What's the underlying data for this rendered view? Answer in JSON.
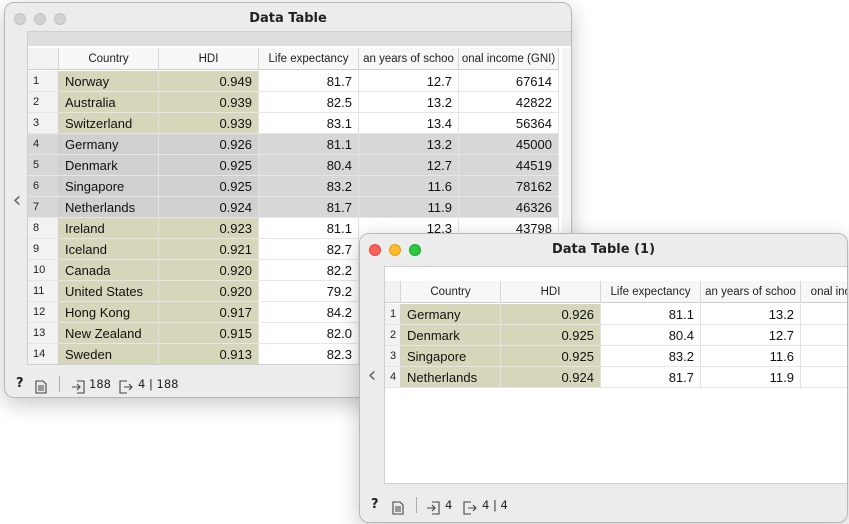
{
  "window1": {
    "title": "Data Table",
    "headers": [
      "Country",
      "HDI",
      "Life expectancy",
      "an years of schoo",
      "onal income (GNI)"
    ],
    "rows": [
      [
        "1",
        "Norway",
        "0.949",
        "81.7",
        "12.7",
        "67614"
      ],
      [
        "2",
        "Australia",
        "0.939",
        "82.5",
        "13.2",
        "42822"
      ],
      [
        "3",
        "Switzerland",
        "0.939",
        "83.1",
        "13.4",
        "56364"
      ],
      [
        "4",
        "Germany",
        "0.926",
        "81.1",
        "13.2",
        "45000"
      ],
      [
        "5",
        "Denmark",
        "0.925",
        "80.4",
        "12.7",
        "44519"
      ],
      [
        "6",
        "Singapore",
        "0.925",
        "83.2",
        "11.6",
        "78162"
      ],
      [
        "7",
        "Netherlands",
        "0.924",
        "81.7",
        "11.9",
        "46326"
      ],
      [
        "8",
        "Ireland",
        "0.923",
        "81.1",
        "12.3",
        "43798"
      ],
      [
        "9",
        "Iceland",
        "0.921",
        "82.7",
        "",
        ""
      ],
      [
        "10",
        "Canada",
        "0.920",
        "82.2",
        "",
        ""
      ],
      [
        "11",
        "United States",
        "0.920",
        "79.2",
        "",
        ""
      ],
      [
        "12",
        "Hong Kong",
        "0.917",
        "84.2",
        "",
        ""
      ],
      [
        "13",
        "New Zealand",
        "0.915",
        "82.0",
        "",
        ""
      ],
      [
        "14",
        "Sweden",
        "0.913",
        "82.3",
        "",
        ""
      ]
    ],
    "selected_rows": [
      4,
      5,
      6,
      7
    ],
    "status": {
      "input_count": "188",
      "output_count": "4 | 188"
    }
  },
  "window2": {
    "title": "Data Table (1)",
    "headers": [
      "Country",
      "HDI",
      "Life expectancy",
      "an years of schoo",
      "onal inc"
    ],
    "rows": [
      [
        "1",
        "Germany",
        "0.926",
        "81.1",
        "13.2",
        ""
      ],
      [
        "2",
        "Denmark",
        "0.925",
        "80.4",
        "12.7",
        ""
      ],
      [
        "3",
        "Singapore",
        "0.925",
        "83.2",
        "11.6",
        ""
      ],
      [
        "4",
        "Netherlands",
        "0.924",
        "81.7",
        "11.9",
        ""
      ]
    ],
    "status": {
      "input_count": "4",
      "output_count": "4 | 4"
    }
  },
  "icons": {
    "help": "?",
    "report": "report-icon",
    "input": "input-icon",
    "output": "output-icon",
    "collapse": "chevron-left-icon"
  },
  "colors": {
    "meta_column": "#d6d6bb",
    "selection": "#d7d7d7"
  }
}
